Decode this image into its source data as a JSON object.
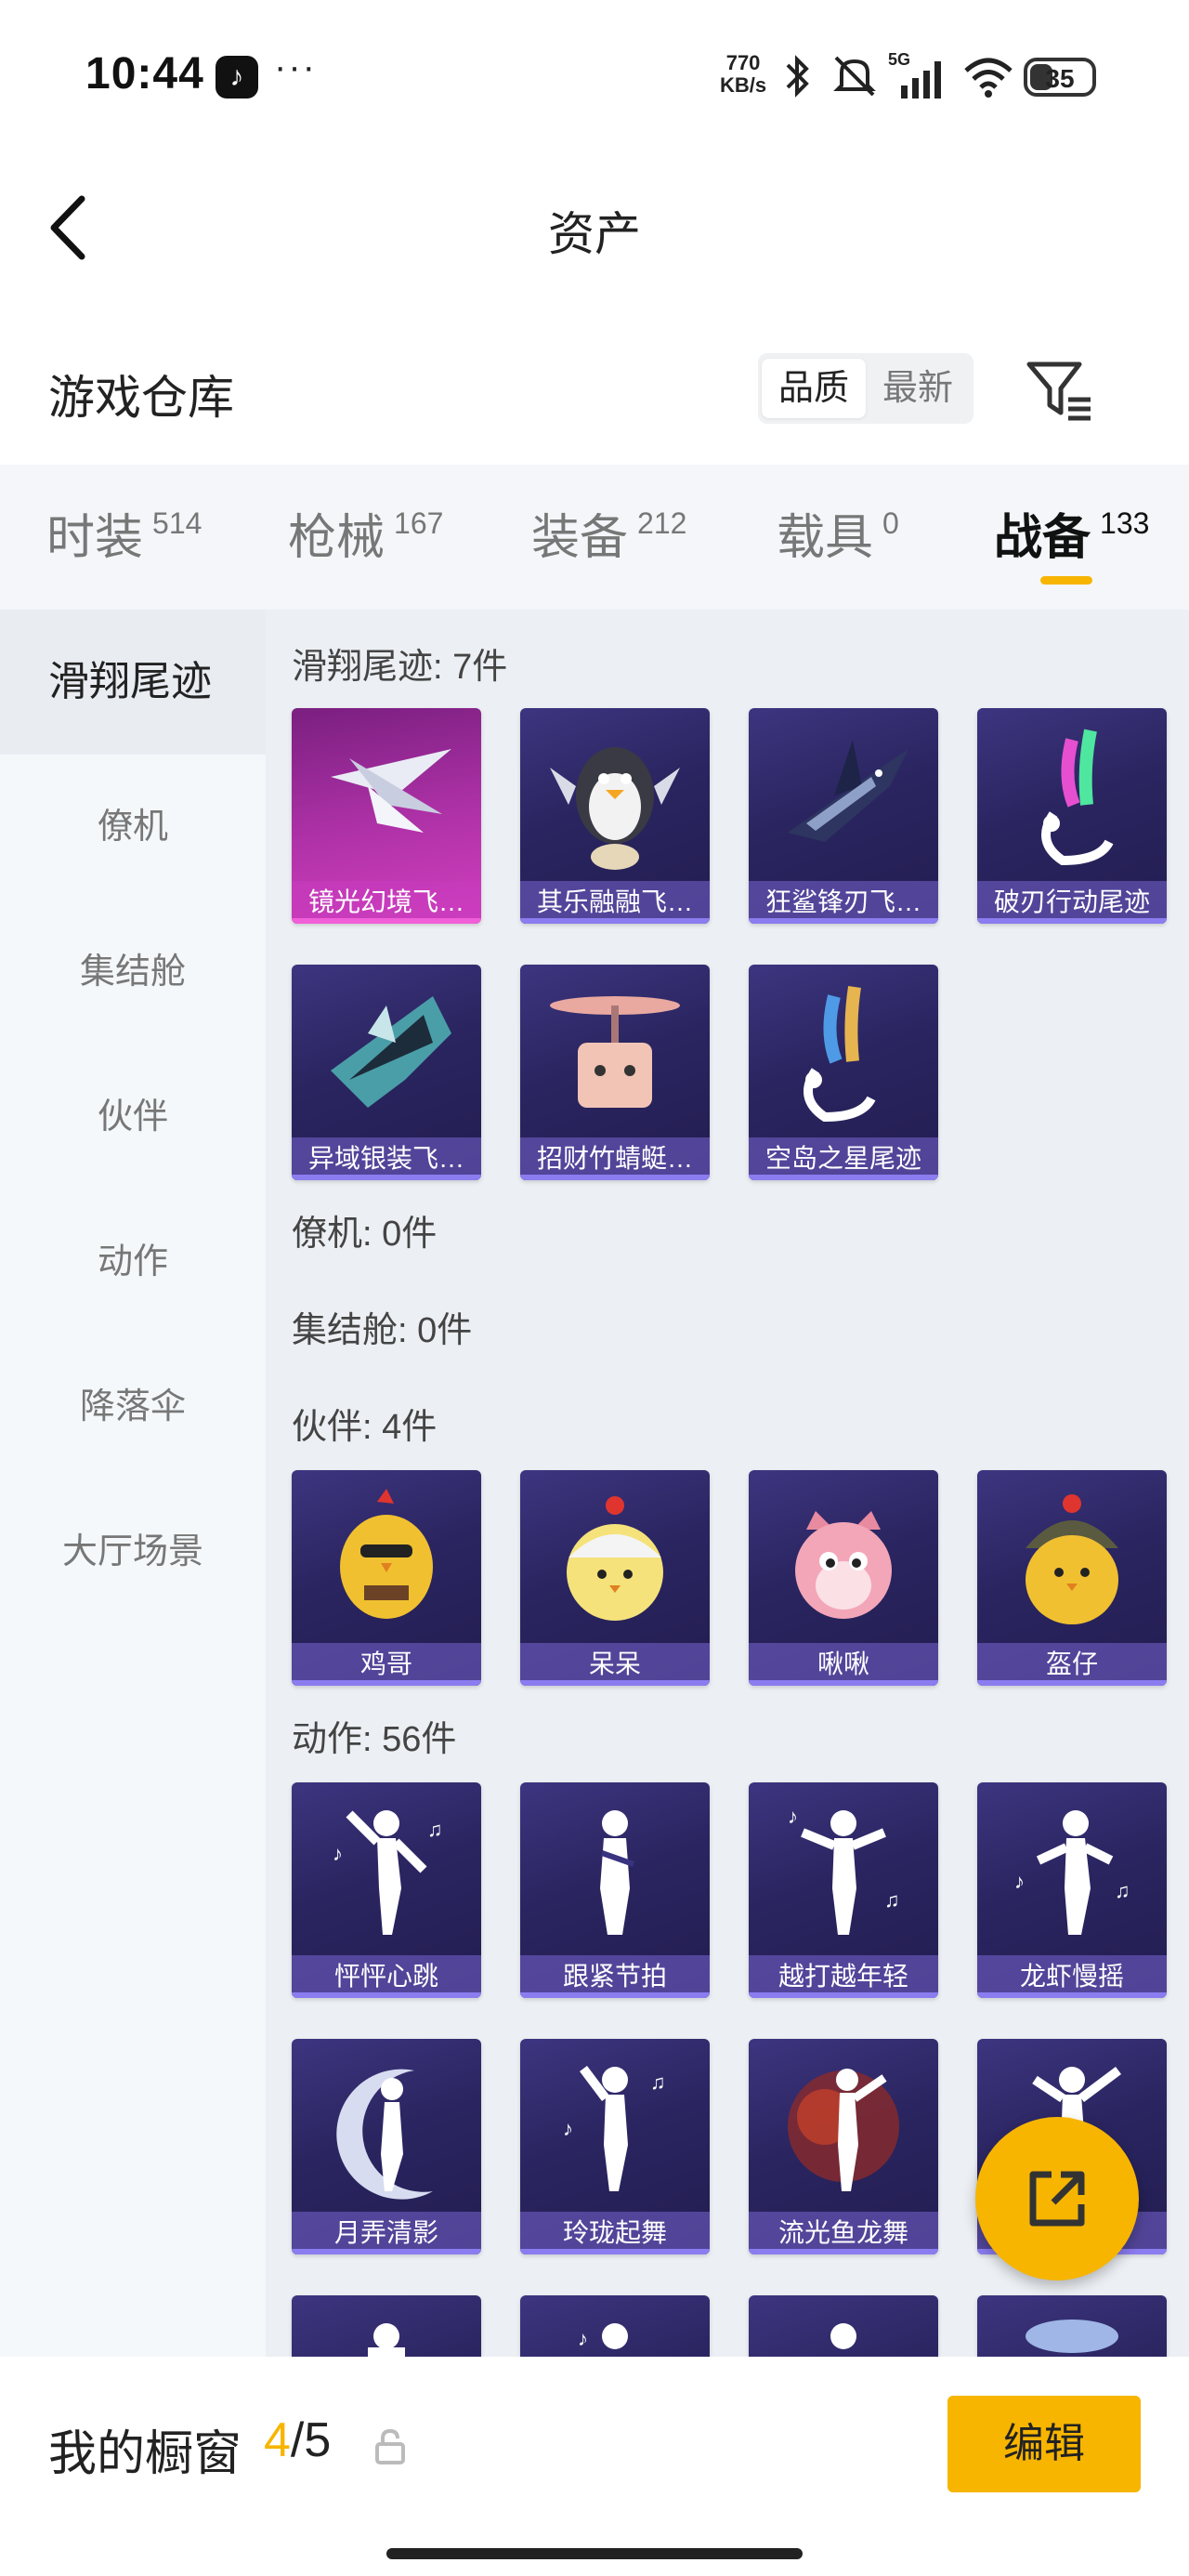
{
  "status_bar": {
    "time": "10:44",
    "app_icon": "tiktok-icon",
    "more": "···",
    "net_speed_value": "770",
    "net_speed_unit": "KB/s",
    "network": "5G",
    "battery": "35"
  },
  "header": {
    "title": "资产",
    "back_icon": "back-arrow-icon"
  },
  "store": {
    "title": "游戏仓库",
    "sort_options": [
      "品质",
      "最新"
    ],
    "selected_sort": "品质",
    "filter_icon": "filter-icon"
  },
  "tabs": [
    {
      "label": "时装",
      "count": "514"
    },
    {
      "label": "枪械",
      "count": "167"
    },
    {
      "label": "装备",
      "count": "212"
    },
    {
      "label": "载具",
      "count": "0"
    },
    {
      "label": "战备",
      "count": "133"
    }
  ],
  "active_tab": "战备",
  "sidebar": [
    "滑翔尾迹",
    "僚机",
    "集结舱",
    "伙伴",
    "动作",
    "降落伞",
    "大厅场景"
  ],
  "active_sidebar": "滑翔尾迹",
  "sections": [
    {
      "title": "滑翔尾迹: 7件",
      "items": [
        "镜光幻境飞…",
        "其乐融融飞…",
        "狂鲨锋刃飞…",
        "破刃行动尾迹",
        "异域银装飞…",
        "招财竹蜻蜓…",
        "空岛之星尾迹"
      ]
    },
    {
      "title": "僚机: 0件",
      "items": []
    },
    {
      "title": "集结舱: 0件",
      "items": []
    },
    {
      "title": "伙伴: 4件",
      "items": [
        "鸡哥",
        "呆呆",
        "啾啾",
        "盔仔"
      ]
    },
    {
      "title": "动作: 56件",
      "items": [
        "怦怦心跳",
        "跟紧节拍",
        "越打越年轻",
        "龙虾慢摇",
        "月弄清影",
        "玲珑起舞",
        "流光鱼龙舞",
        ""
      ]
    }
  ],
  "colors": {
    "accent": "#f7b500",
    "card_bg": "#2a2560",
    "card_pink": "#b032a8"
  },
  "bottom": {
    "label": "我的橱窗",
    "current": "4",
    "separator": "/",
    "total": "5",
    "lock_icon": "lock-icon",
    "edit_button": "编辑"
  },
  "fab_icon": "share-icon"
}
